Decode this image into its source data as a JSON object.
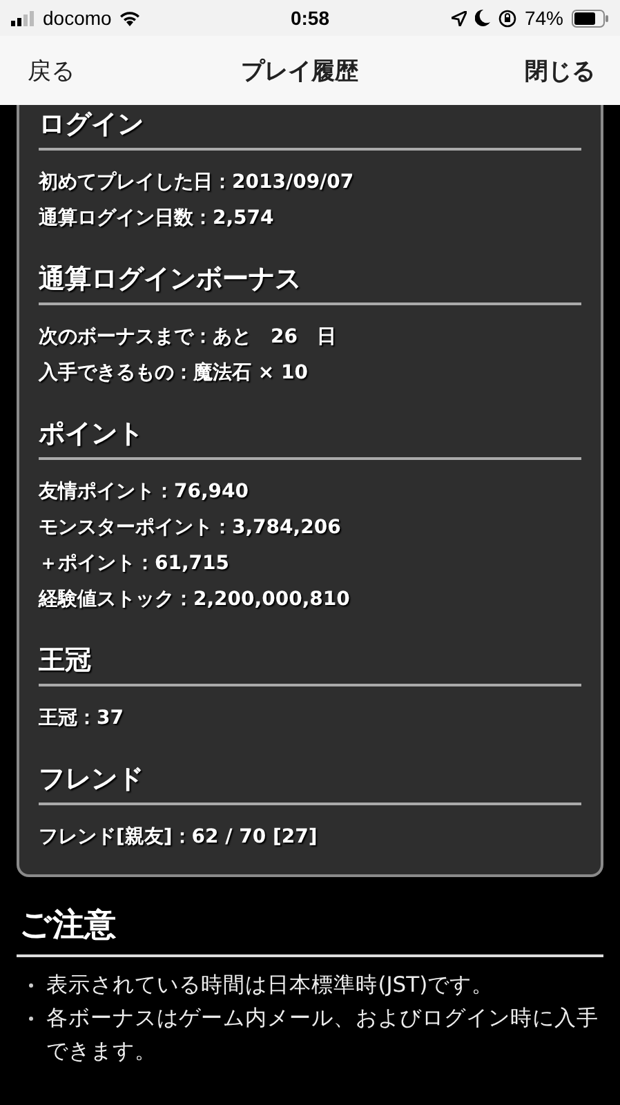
{
  "status_bar": {
    "carrier": "docomo",
    "time": "0:58",
    "battery": "74%"
  },
  "nav_bar": {
    "back": "戻る",
    "title": "プレイ履歴",
    "close": "閉じる"
  },
  "sections": [
    {
      "heading": "ログイン",
      "lines": [
        "初めてプレイした日：2013/09/07",
        "通算ログイン日数：2,574"
      ]
    },
    {
      "heading": "通算ログインボーナス",
      "lines": [
        "次のボーナスまで：あと　26　日",
        "入手できるもの：魔法石 × 10"
      ]
    },
    {
      "heading": "ポイント",
      "lines": [
        "友情ポイント：76,940",
        "モンスターポイント：3,784,206",
        "＋ポイント：61,715",
        "経験値ストック：2,200,000,810"
      ]
    },
    {
      "heading": "王冠",
      "lines": [
        "王冠：37"
      ]
    },
    {
      "heading": "フレンド",
      "lines": [
        "フレンド[親友]：62 / 70 [27]"
      ]
    }
  ],
  "notes": {
    "heading": "ご注意",
    "items": [
      "表示されている時間は日本標準時(JST)です。",
      "各ボーナスはゲーム内メール、およびログイン時に入手できます。"
    ]
  }
}
